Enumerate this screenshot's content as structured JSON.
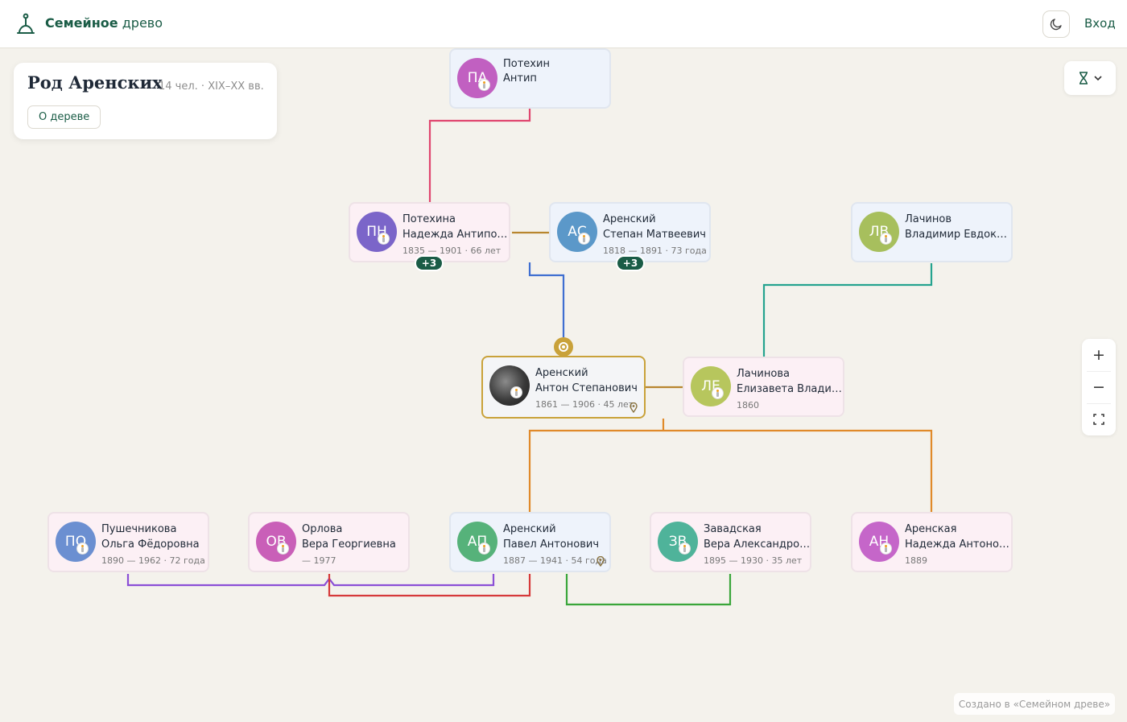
{
  "header": {
    "brand_bold": "Семейное",
    "brand_rest": "древо",
    "login_label": "Вход"
  },
  "tree_info": {
    "title": "Род Аренских",
    "subtitle": "14 чел. · XIX–XX вв.",
    "about_label": "О дереве"
  },
  "zoom": {
    "in": "+",
    "out": "−"
  },
  "people": {
    "potekhin_antip": {
      "initials": "ПА",
      "surname": "Потехин",
      "given": "Антип",
      "dates": "",
      "color": "#c160c1",
      "gender": "male"
    },
    "potekhina_nadezhda": {
      "initials": "ПН",
      "surname": "Потехина",
      "given": "Надежда Антиповна",
      "dates": "1835 — 1901 · 66 лет",
      "color": "#7b65c9",
      "gender": "female",
      "more": "+3"
    },
    "arensky_stepan": {
      "initials": "АС",
      "surname": "Аренский",
      "given": "Степан Матвеевич",
      "dates": "1818 — 1891 · 73 года",
      "color": "#5b98c9",
      "gender": "male",
      "more": "+3"
    },
    "lachinov_vladimir": {
      "initials": "ЛВ",
      "surname": "Лачинов",
      "given": "Владимир Евдокимович",
      "dates": "",
      "color": "#a7bf5d",
      "gender": "male"
    },
    "arensky_anton": {
      "initials": "",
      "surname": "Аренский",
      "given": "Антон Степанович",
      "dates": "1861 — 1906 · 45 лет",
      "color": "#333333",
      "gender": "male"
    },
    "lachinova_elizaveta": {
      "initials": "ЛЕ",
      "surname": "Лачинова",
      "given": "Елизавета Владимировна",
      "dates": "1860",
      "color": "#b7c65d",
      "gender": "female"
    },
    "pushechnikova_olga": {
      "initials": "ПО",
      "surname": "Пушечникова",
      "given": "Ольга Фёдоровна",
      "dates": "1890 — 1962 · 72 года",
      "color": "#6b8fd1",
      "gender": "female"
    },
    "orlova_vera": {
      "initials": "ОВ",
      "surname": "Орлова",
      "given": "Вера Георгиевна",
      "dates": "— 1977",
      "color": "#c95fb8",
      "gender": "female"
    },
    "arensky_pavel": {
      "initials": "АП",
      "surname": "Аренский",
      "given": "Павел Антонович",
      "dates": "1887 — 1941 · 54 года",
      "color": "#56b27a",
      "gender": "male"
    },
    "zavadskaya_vera": {
      "initials": "ЗВ",
      "surname": "Завадская",
      "given": "Вера Александровна",
      "dates": "1895 — 1930 · 35 лет",
      "color": "#4fb39a",
      "gender": "female"
    },
    "arenskaya_nadezhda": {
      "initials": "АН",
      "surname": "Аренская",
      "given": "Надежда Антоновна",
      "dates": "1889",
      "color": "#c566c9",
      "gender": "female"
    }
  },
  "link_colors": {
    "potekhin_line": "#e0476f",
    "spouse_line": "#b8862e",
    "stepan_line": "#3f6fd1",
    "lachinov_line": "#25a38f",
    "children_line": "#e08a2a",
    "olga_line": "#8b4fd6",
    "vera_line": "#d63a3a",
    "zavadskaya_line": "#3aa63a"
  },
  "footer": {
    "text": "Создано в «Семейном древе»"
  }
}
